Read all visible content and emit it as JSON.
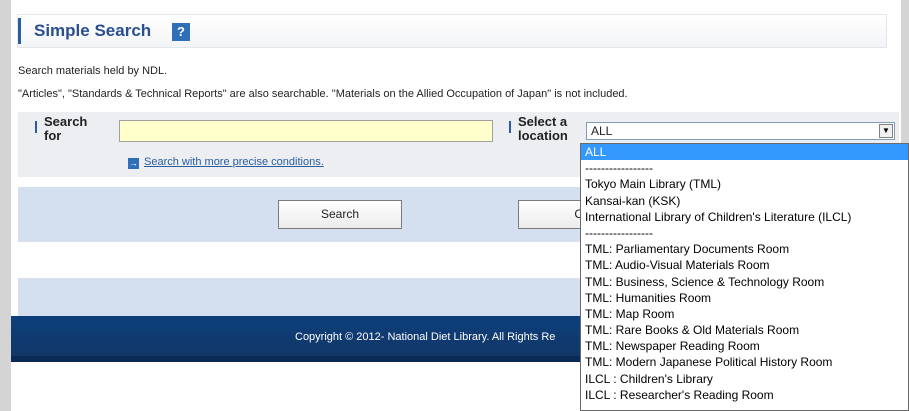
{
  "header": {
    "title": "Simple Search",
    "help_icon_glyph": "?"
  },
  "description": {
    "line1": "Search materials held by NDL.",
    "line2": "\"Articles\", \"Standards & Technical Reports\" are also searchable. \"Materials on the Allied Occupation of Japan\" is not included."
  },
  "search_form": {
    "search_label_line1": "Search",
    "search_label_line2": "for",
    "search_input_value": "",
    "more_conditions_link": "Search with more precise conditions.",
    "location_label_line1": "Select a",
    "location_label_line2": "location",
    "location_selected": "ALL"
  },
  "buttons": {
    "search": "Search",
    "clear_partial": "Cl"
  },
  "footer": {
    "copyright": "Copyright © 2012- National Diet Library. All Rights Re"
  },
  "location_options": [
    "ALL",
    "-----------------",
    "Tokyo Main Library (TML)",
    "Kansai-kan (KSK)",
    "International Library of Children's Literature (ILCL)",
    "-----------------",
    "TML: Parliamentary Documents Room",
    "TML: Audio-Visual Materials Room",
    "TML: Business, Science & Technology Room",
    "TML: Humanities Room",
    "TML: Map Room",
    "TML: Rare Books & Old Materials Room",
    "TML: Newspaper Reading Room",
    "TML: Modern Japanese Political History Room",
    "ILCL : Children's Library",
    "ILCL : Researcher's Reading Room"
  ],
  "colors": {
    "accent": "#2a5d9f",
    "selected_option": "#3399ff",
    "input_background": "#ffffcc",
    "footer": "#123563"
  },
  "icons": {
    "help": "help-icon",
    "link_arrow": "arrow-right-icon",
    "dropdown": "chevron-down-icon"
  }
}
